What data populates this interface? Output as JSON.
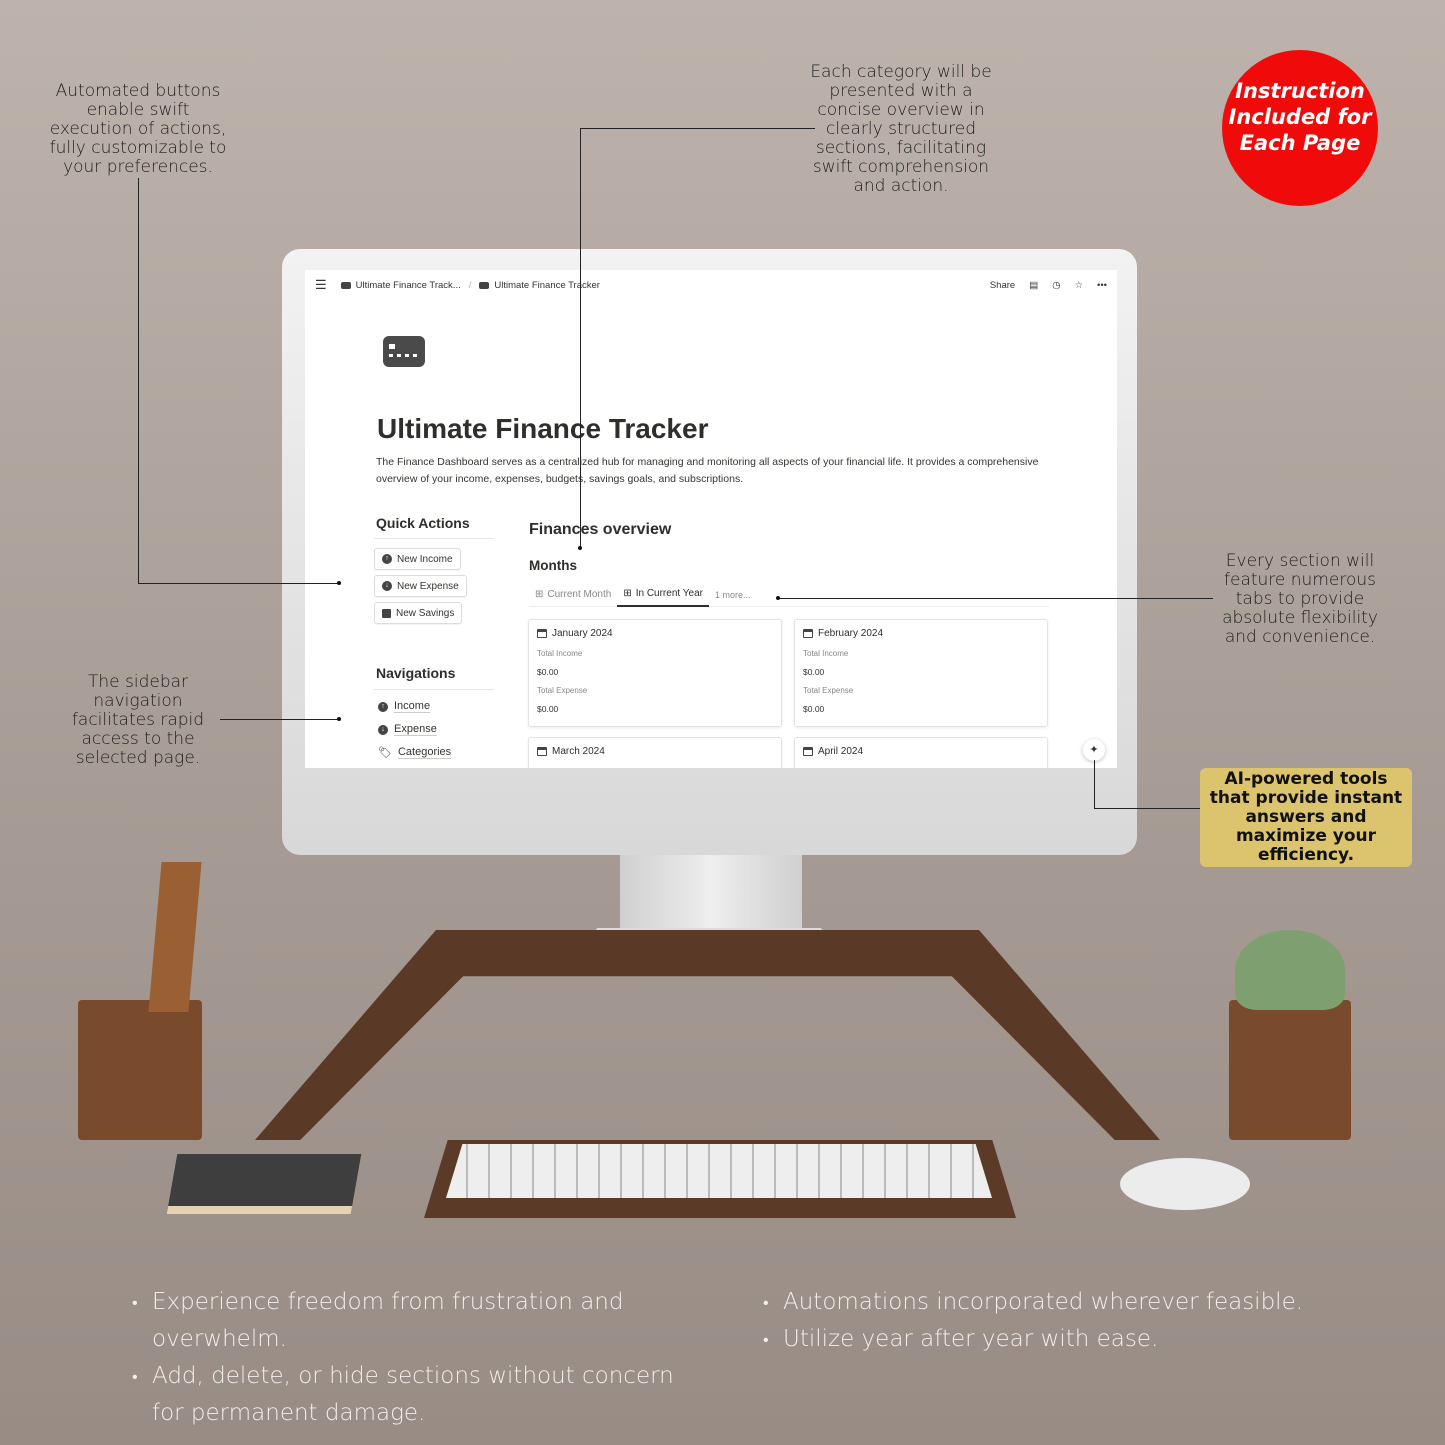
{
  "annotations": {
    "quick_actions": "Automated buttons enable swift execution of actions, fully customizable to your preferences.",
    "categories": "Each category will be presented with a concise overview in clearly structured sections, facilitating swift comprehension and action.",
    "tabs": "Every section will feature numerous tabs to provide absolute flexibility and convenience.",
    "sidebar": "The sidebar navigation facilitates rapid access to the selected page.",
    "ai": "AI-powered tools that provide instant answers and maximize your efficiency."
  },
  "badge": {
    "text": "Instruction Included for Each Page",
    "color": "#f00a0a"
  },
  "topbar": {
    "breadcrumb": [
      "Ultimate Finance Track...",
      "Ultimate Finance Tracker"
    ],
    "share": "Share",
    "icons": [
      "menu-icon",
      "comment-icon",
      "clock-icon",
      "star-icon",
      "more-icon"
    ]
  },
  "page": {
    "title": "Ultimate Finance Tracker",
    "description": "The Finance Dashboard serves as a centralized hub for managing and monitoring all aspects of your financial life. It provides a comprehensive overview of your income, expenses, budgets, savings goals, and subscriptions.",
    "quick_actions": {
      "title": "Quick Actions",
      "buttons": [
        "New Income",
        "New Expense",
        "New Savings"
      ]
    },
    "navigations": {
      "title": "Navigations",
      "items": [
        "Income",
        "Expense",
        "Categories"
      ]
    },
    "overview": {
      "title": "Finances overview",
      "subtitle": "Months",
      "tabs": [
        "Current Month",
        "In Current Year",
        "1 more..."
      ],
      "active_tab": "In Current Year",
      "cards": [
        {
          "title": "January 2024",
          "income_label": "Total Income",
          "income": "$0.00",
          "expense_label": "Total Expense",
          "expense": "$0.00"
        },
        {
          "title": "February 2024",
          "income_label": "Total Income",
          "income": "$0.00",
          "expense_label": "Total Expense",
          "expense": "$0.00"
        },
        {
          "title": "March 2024"
        },
        {
          "title": "April 2024"
        }
      ]
    }
  },
  "bullets_left": [
    "Experience freedom from frustration and overwhelm.",
    "Add, delete, or hide sections without concern for permanent damage."
  ],
  "bullets_right": [
    "Automations incorporated wherever feasible.",
    "Utilize year after year with ease."
  ]
}
